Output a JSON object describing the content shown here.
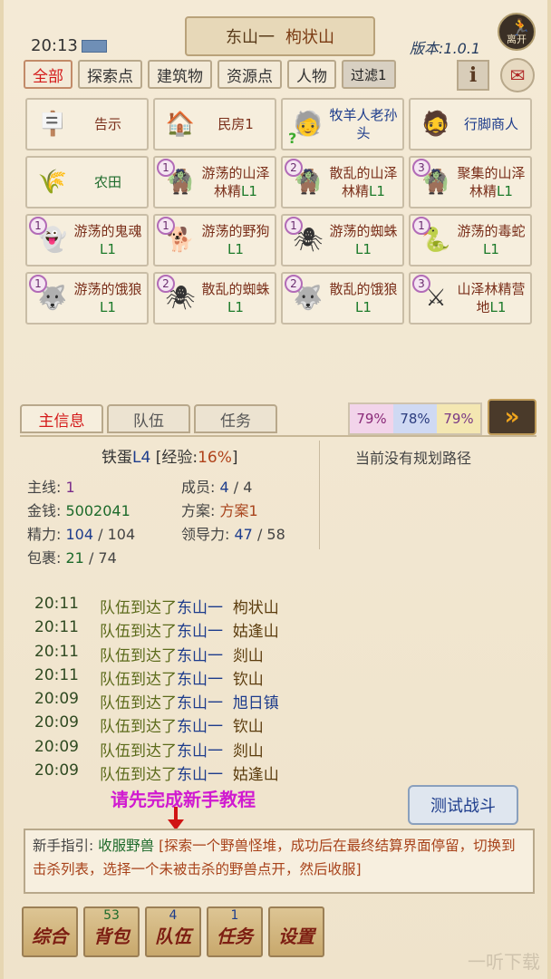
{
  "header": {
    "time": "20:13",
    "location_area": "东山一",
    "location_place": "枸状山",
    "version": "版本:1.0.1",
    "leave_label": "离开"
  },
  "filter_tabs": [
    {
      "label": "全部",
      "active": true
    },
    {
      "label": "探索点",
      "active": false
    },
    {
      "label": "建筑物",
      "active": false
    },
    {
      "label": "资源点",
      "active": false
    },
    {
      "label": "人物",
      "active": false
    },
    {
      "label": "过滤1",
      "active": false
    }
  ],
  "grid": [
    {
      "icon": "signpost-icon",
      "name": "告示",
      "level": "",
      "badge": "",
      "kind": "building"
    },
    {
      "icon": "house-icon",
      "name": "民房1",
      "level": "",
      "badge": "",
      "kind": "building"
    },
    {
      "icon": "old-shepherd-icon",
      "name": "牧羊人老孙头",
      "level": "",
      "badge": "",
      "kind": "npc",
      "quest": "?"
    },
    {
      "icon": "merchant-icon",
      "name": "行脚商人",
      "level": "",
      "badge": "",
      "kind": "npc"
    },
    {
      "icon": "farmland-icon",
      "name": "农田",
      "level": "",
      "badge": "",
      "kind": "place"
    },
    {
      "icon": "goblin-icon",
      "name": "游荡的山泽林精",
      "level": "L1",
      "badge": "1",
      "kind": "monster"
    },
    {
      "icon": "goblin-icon",
      "name": "散乱的山泽林精",
      "level": "L1",
      "badge": "2",
      "kind": "monster"
    },
    {
      "icon": "goblin-icon",
      "name": "聚集的山泽林精",
      "level": "L1",
      "badge": "3",
      "kind": "monster"
    },
    {
      "icon": "ghost-icon",
      "name": "游荡的鬼魂",
      "level": "L1",
      "badge": "1",
      "kind": "monster"
    },
    {
      "icon": "dog-icon",
      "name": "游荡的野狗",
      "level": "L1",
      "badge": "1",
      "kind": "monster"
    },
    {
      "icon": "spider-icon",
      "name": "游荡的蜘蛛",
      "level": "L1",
      "badge": "1",
      "kind": "monster"
    },
    {
      "icon": "snake-icon",
      "name": "游荡的毒蛇",
      "level": "L1",
      "badge": "1",
      "kind": "monster"
    },
    {
      "icon": "wolf-icon",
      "name": "游荡的饿狼",
      "level": "L1",
      "badge": "1",
      "kind": "monster"
    },
    {
      "icon": "spider-icon",
      "name": "散乱的蜘蛛",
      "level": "L1",
      "badge": "2",
      "kind": "monster"
    },
    {
      "icon": "wolf-icon",
      "name": "散乱的饿狼",
      "level": "L1",
      "badge": "2",
      "kind": "monster"
    },
    {
      "icon": "orc-camp-icon",
      "name": "山泽林精营地",
      "level": "L1",
      "badge": "3",
      "kind": "monster"
    }
  ],
  "info_tabs": [
    {
      "label": "主信息",
      "active": true
    },
    {
      "label": "队伍",
      "active": false
    },
    {
      "label": "任务",
      "active": false
    }
  ],
  "percents": [
    "79%",
    "78%",
    "79%"
  ],
  "hero": {
    "name": "铁蛋",
    "level": "L4",
    "exp_label": "经验:",
    "exp_value": "16%",
    "route": "当前没有规划路径"
  },
  "stats": {
    "mainline_label": "主线:",
    "mainline": "1",
    "money_label": "金钱:",
    "money": "5002041",
    "energy_label": "精力:",
    "energy": "104",
    "energy_max": "104",
    "bag_label": "包裹:",
    "bag": "21",
    "bag_max": "74",
    "members_label": "成员:",
    "members": "4",
    "members_max": "4",
    "plan_label": "方案:",
    "plan": "方案1",
    "lead_label": "领导力:",
    "lead": "47",
    "lead_max": "58"
  },
  "log": [
    {
      "time": "20:11",
      "msg": "队伍到达了",
      "region": "东山一",
      "place": "枸状山",
      "blue": false
    },
    {
      "time": "20:11",
      "msg": "队伍到达了",
      "region": "东山一",
      "place": "姑逢山",
      "blue": false
    },
    {
      "time": "20:11",
      "msg": "队伍到达了",
      "region": "东山一",
      "place": "剡山",
      "blue": false
    },
    {
      "time": "20:11",
      "msg": "队伍到达了",
      "region": "东山一",
      "place": "钦山",
      "blue": false
    },
    {
      "time": "20:09",
      "msg": "队伍到达了",
      "region": "东山一",
      "place": "旭日镇",
      "blue": true
    },
    {
      "time": "20:09",
      "msg": "队伍到达了",
      "region": "东山一",
      "place": "钦山",
      "blue": false
    },
    {
      "time": "20:09",
      "msg": "队伍到达了",
      "region": "东山一",
      "place": "剡山",
      "blue": false
    },
    {
      "time": "20:09",
      "msg": "队伍到达了",
      "region": "东山一",
      "place": "姑逢山",
      "blue": false
    }
  ],
  "tutorial_warning": "请先完成新手教程",
  "test_battle": "测试战斗",
  "guide": {
    "label": "新手指引:",
    "title": "收服野兽",
    "text": "[探索一个野兽怪堆，成功后在最终结算界面停留，切换到击杀列表，选择一个未被击杀的野兽点开，然后收服]"
  },
  "nav": [
    {
      "label": "综合",
      "count": ""
    },
    {
      "label": "背包",
      "count": "53"
    },
    {
      "label": "队伍",
      "count": "4"
    },
    {
      "label": "任务",
      "count": "1"
    },
    {
      "label": "设置",
      "count": ""
    }
  ],
  "watermark": "一听下载"
}
